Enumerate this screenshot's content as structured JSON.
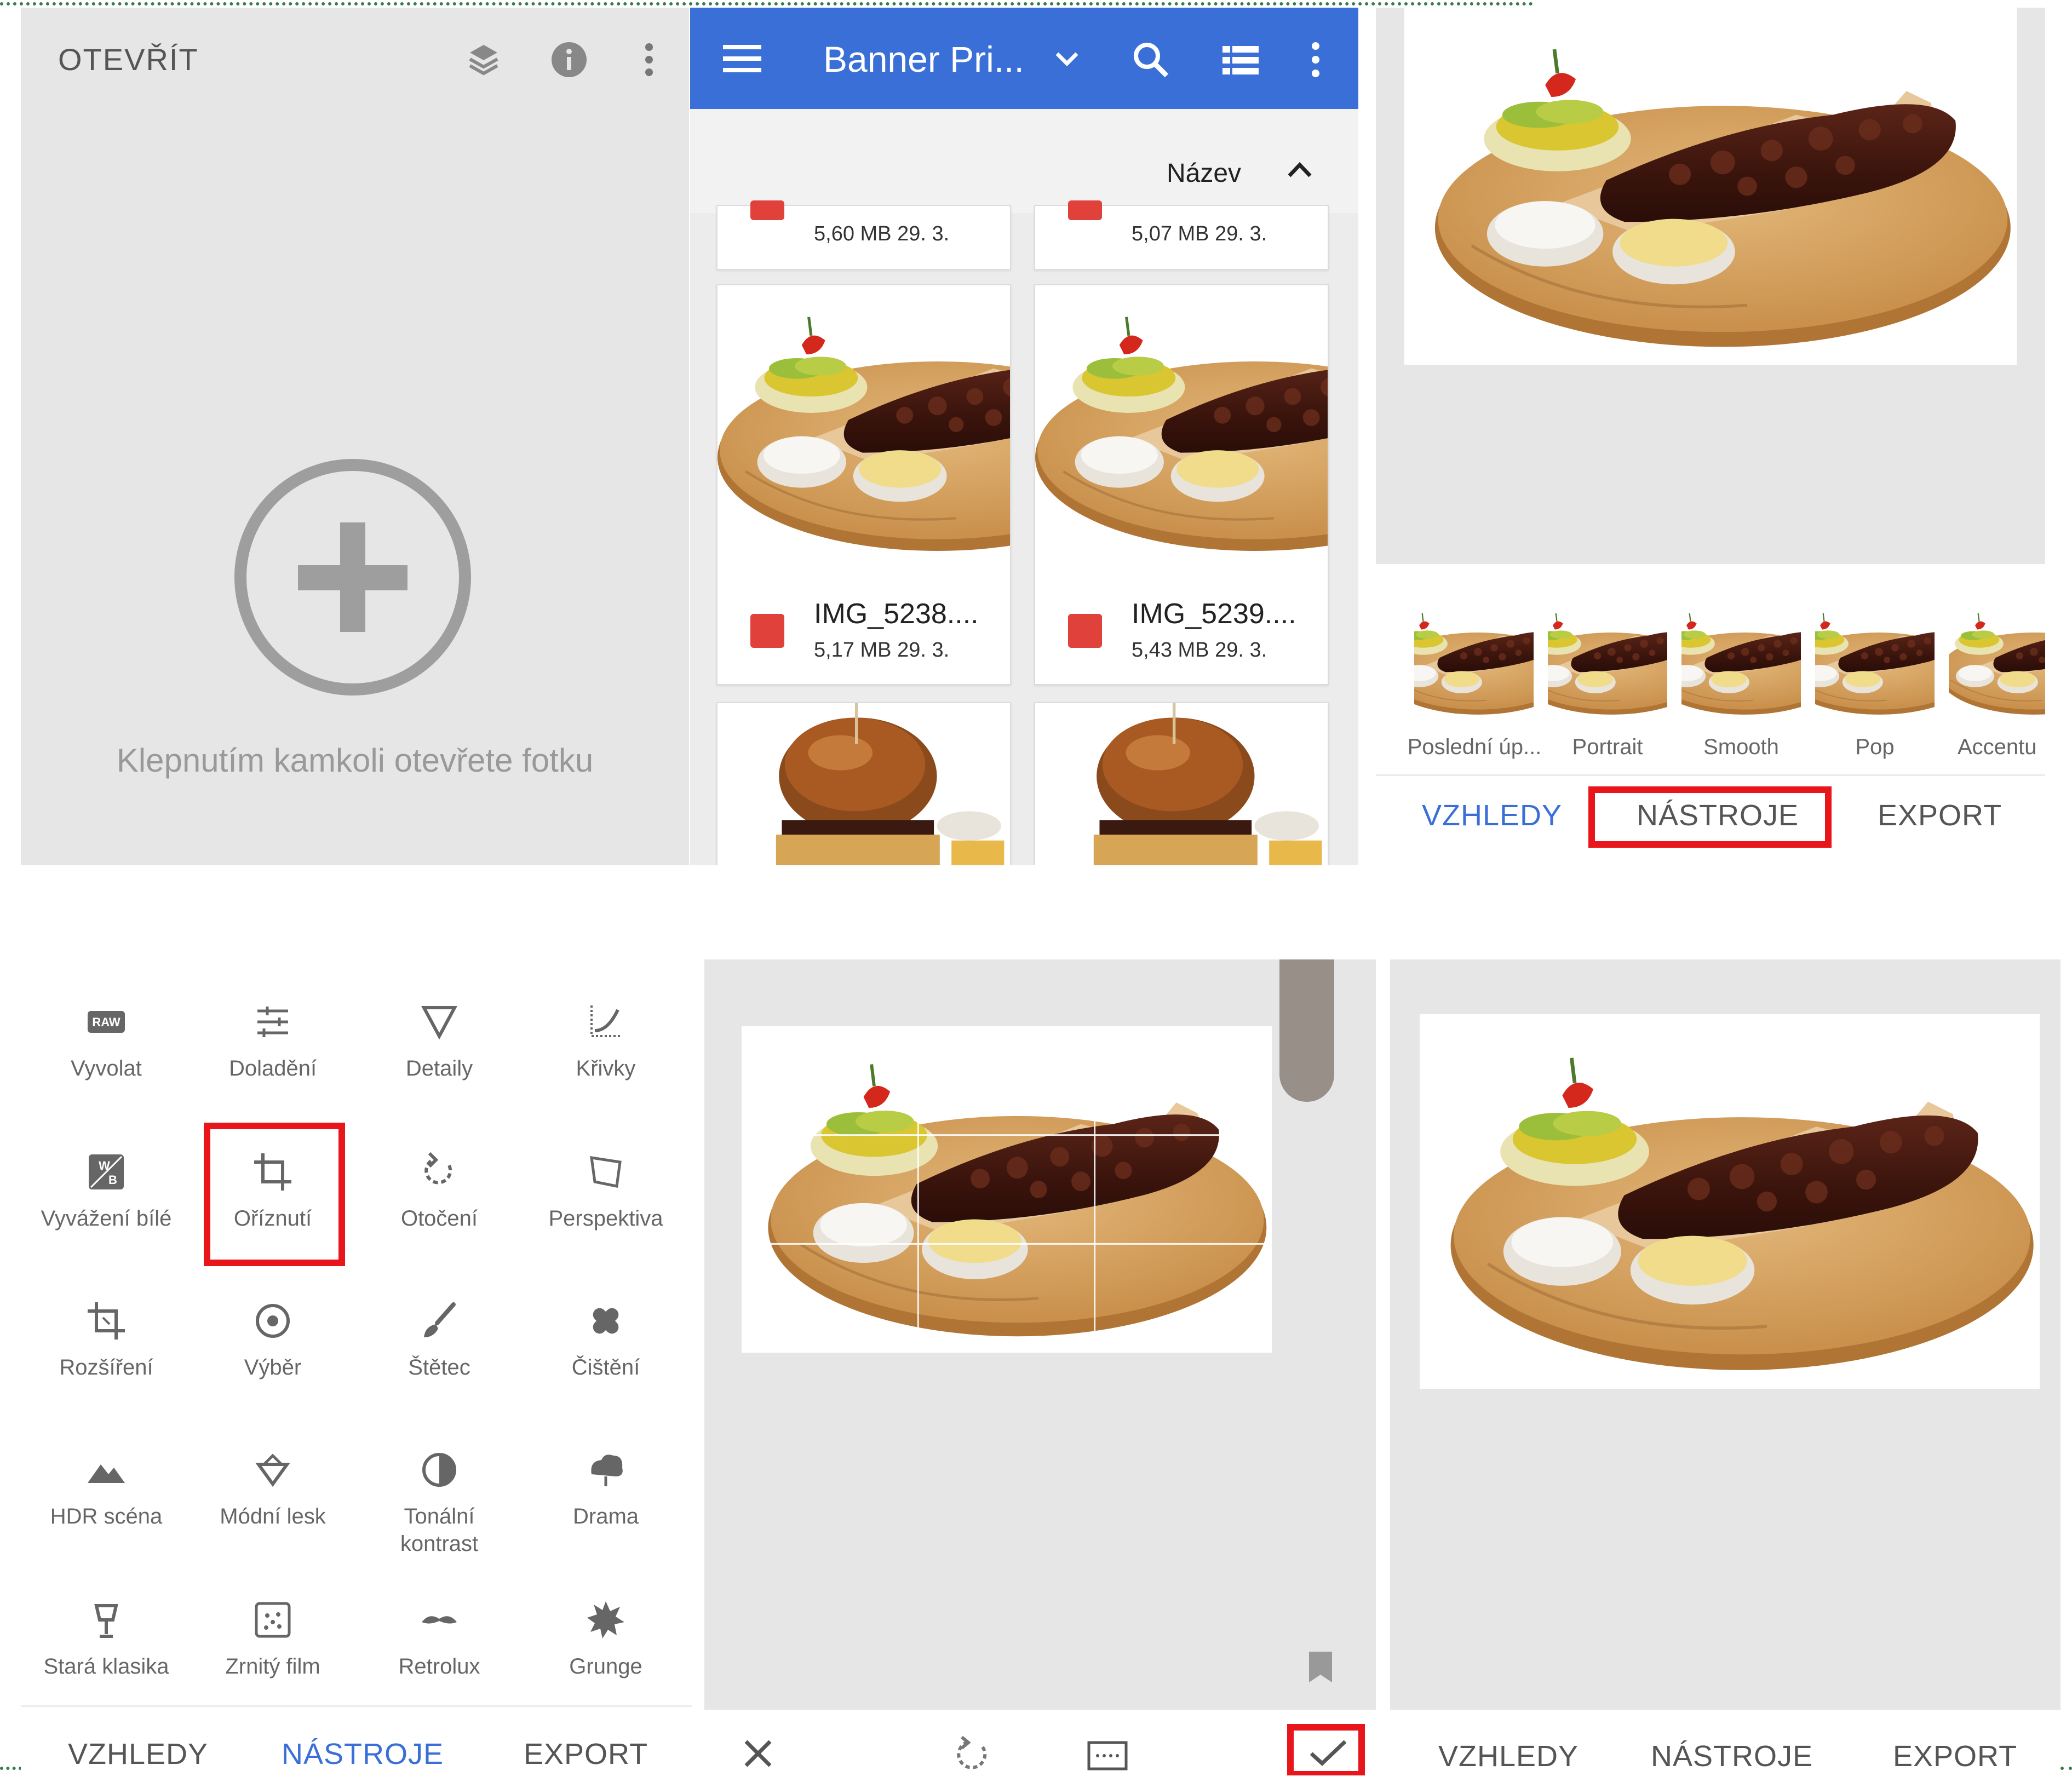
{
  "colors": {
    "accent": "#3b6fd8",
    "highlight": "#e8151b",
    "canvas_gray": "#e6e6e6"
  },
  "panel1": {
    "title": "OTEVŘÍT",
    "icons": [
      "layers-icon",
      "info-icon",
      "more-vert-icon",
      "add-circle-icon"
    ],
    "hint": "Klepnutím kamkoli otevřete fotku"
  },
  "panel2": {
    "title": "Banner Pri...",
    "icons": [
      "menu-icon",
      "chevron-down-icon",
      "search-icon",
      "list-view-icon",
      "more-vert-icon"
    ],
    "sort_label": "Název",
    "files": [
      {
        "meta": "5,60 MB 29. 3."
      },
      {
        "meta": "5,07 MB 29. 3."
      },
      {
        "name": "IMG_5238....",
        "meta": "5,17 MB 29. 3."
      },
      {
        "name": "IMG_5239....",
        "meta": "5,43 MB 29. 3."
      }
    ]
  },
  "panel3": {
    "looks": [
      {
        "label": "Poslední úp..."
      },
      {
        "label": "Portrait"
      },
      {
        "label": "Smooth"
      },
      {
        "label": "Pop"
      },
      {
        "label": "Accentu"
      }
    ],
    "tabs": {
      "looks": "VZHLEDY",
      "tools": "NÁSTROJE",
      "export": "EXPORT"
    }
  },
  "panel4": {
    "tools": [
      {
        "label": "Vyvolat",
        "icon": "raw-icon"
      },
      {
        "label": "Doladění",
        "icon": "tune-icon"
      },
      {
        "label": "Detaily",
        "icon": "details-icon"
      },
      {
        "label": "Křivky",
        "icon": "curves-icon"
      },
      {
        "label": "Vyvážení bílé",
        "icon": "white-balance-icon"
      },
      {
        "label": "Oříznutí",
        "icon": "crop-icon"
      },
      {
        "label": "Otočení",
        "icon": "rotate-icon"
      },
      {
        "label": "Perspektiva",
        "icon": "perspective-icon"
      },
      {
        "label": "Rozšíření",
        "icon": "expand-icon"
      },
      {
        "label": "Výběr",
        "icon": "selective-icon"
      },
      {
        "label": "Štětec",
        "icon": "brush-icon"
      },
      {
        "label": "Čištění",
        "icon": "healing-icon"
      },
      {
        "label": "HDR scéna",
        "icon": "hdr-icon"
      },
      {
        "label": "Módní lesk",
        "icon": "glamour-icon"
      },
      {
        "label": "Tonální kontrast",
        "icon": "tonal-contrast-icon"
      },
      {
        "label": "Drama",
        "icon": "drama-icon"
      },
      {
        "label": "Stará klasika",
        "icon": "vintage-icon"
      },
      {
        "label": "Zrnitý film",
        "icon": "grainy-film-icon"
      },
      {
        "label": "Retrolux",
        "icon": "retrolux-icon"
      },
      {
        "label": "Grunge",
        "icon": "grunge-icon"
      }
    ],
    "tabs": {
      "looks": "VZHLEDY",
      "tools": "NÁSTROJE",
      "export": "EXPORT"
    }
  },
  "panel5": {
    "icons": [
      "close-icon",
      "rotate-icon",
      "aspect-ratio-icon",
      "check-icon",
      "bookmark-icon"
    ]
  },
  "panel6": {
    "tabs": {
      "looks": "VZHLEDY",
      "tools": "NÁSTROJE",
      "export": "EXPORT"
    }
  }
}
